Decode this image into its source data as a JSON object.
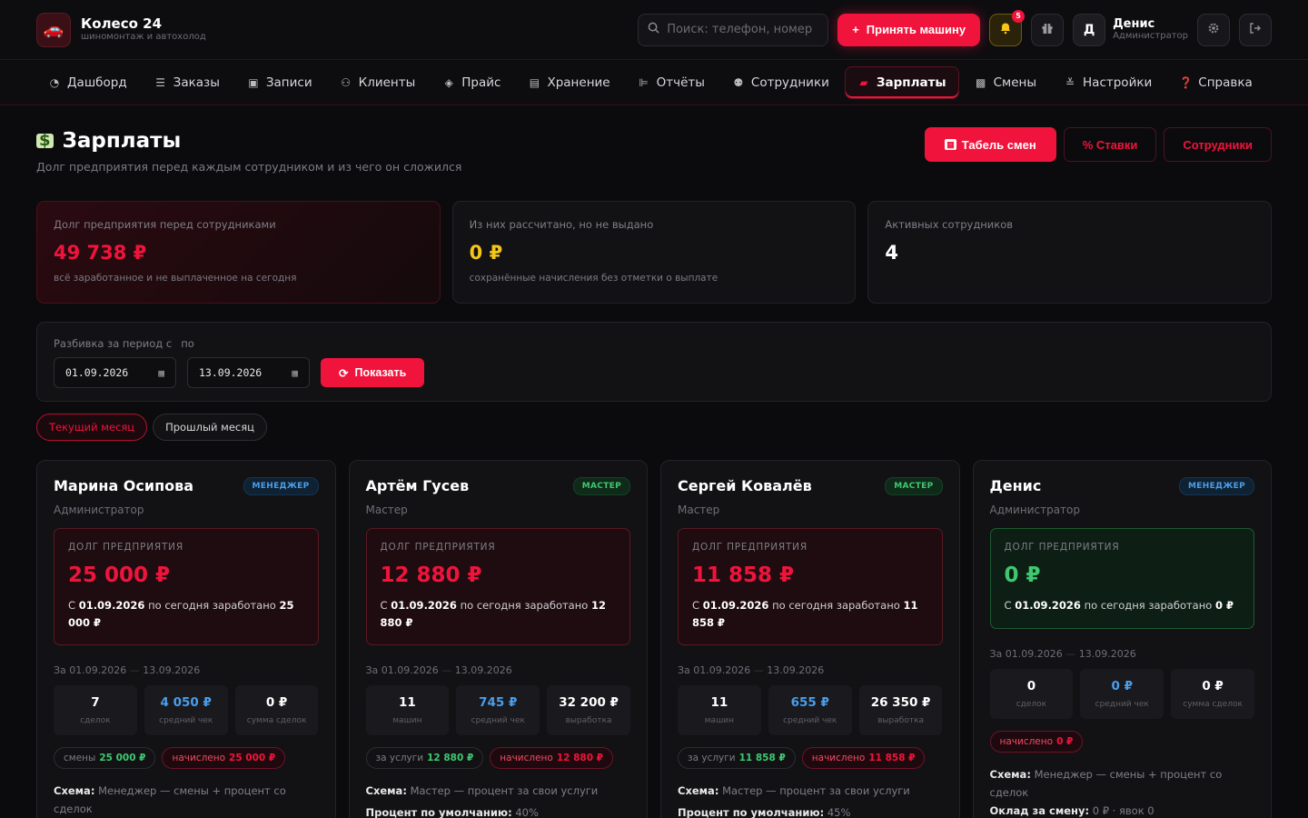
{
  "brand": {
    "title": "Колесо 24",
    "subtitle": "шиномонтаж и автохолод"
  },
  "header": {
    "search_placeholder": "Поиск: телефон, номер",
    "accept_label": "Принять машину",
    "notifications_count": "5",
    "user_initial": "Д",
    "user_name": "Денис",
    "user_role": "Администратор"
  },
  "nav": [
    {
      "label": "Дашборд",
      "icon": "chart-pie-icon"
    },
    {
      "label": "Заказы",
      "icon": "list-icon"
    },
    {
      "label": "Записи",
      "icon": "calendar-icon"
    },
    {
      "label": "Клиенты",
      "icon": "users-icon"
    },
    {
      "label": "Прайс",
      "icon": "tag-icon"
    },
    {
      "label": "Хранение",
      "icon": "warehouse-icon"
    },
    {
      "label": "Отчёты",
      "icon": "report-icon"
    },
    {
      "label": "Сотрудники",
      "icon": "staff-icon"
    },
    {
      "label": "Зарплаты",
      "icon": "money-icon",
      "active": true
    },
    {
      "label": "Смены",
      "icon": "shift-icon"
    },
    {
      "label": "Настройки",
      "icon": "sliders-icon"
    },
    {
      "label": "Справка",
      "icon": "help-icon"
    }
  ],
  "page": {
    "title": "Зарплаты",
    "subtitle": "Долг предприятия перед каждым сотрудником и из чего он сложился",
    "btn_timesheet": "Табель смен",
    "btn_rates": "% Ставки",
    "btn_staff": "Сотрудники"
  },
  "stats": [
    {
      "label": "Долг предприятия перед сотрудниками",
      "value": "49 738 ₽",
      "note": "всё заработанное и не выплаченное на сегодня",
      "color": "#f0143c"
    },
    {
      "label": "Из них рассчитано, но не выдано",
      "value": "0 ₽",
      "note": "сохранённые начисления без отметки о выплате",
      "color": "#f5c518"
    },
    {
      "label": "Активных сотрудников",
      "value": "4",
      "note": "",
      "color": "#ffffff"
    }
  ],
  "period": {
    "label_from": "Разбивка за период с",
    "label_to": "по",
    "date_from": "01.09.2026",
    "date_to": "13.09.2026",
    "show_label": "Показать",
    "chip_current": "Текущий месяц",
    "chip_previous": "Прошлый месяц"
  },
  "employees": [
    {
      "name": "Марина Осипова",
      "role": "Администратор",
      "badge": "МЕНЕДЖЕР",
      "debt_title": "ДОЛГ ПРЕДПРИЯТИЯ",
      "debt_value": "25 000 ₽",
      "debt_desc_pre": "С",
      "debt_from": "01.09.2026",
      "debt_desc_mid": "по сегодня заработано",
      "debt_earned": "25 000 ₽",
      "period_from": "За 01.09.2026",
      "period_to": "13.09.2026",
      "mini": [
        {
          "val": "7",
          "lbl": "сделок"
        },
        {
          "val": "4 050 ₽",
          "lbl": "средний чек"
        },
        {
          "val": "0 ₽",
          "lbl": "сумма сделок"
        }
      ],
      "pill1_pre": "смены",
      "pill1_val": "25 000 ₽",
      "pill2_pre": "начислено",
      "pill2_val": "25 000 ₽",
      "scheme_label": "Схема:",
      "scheme_text": "Менеджер — смены + процент со сделок",
      "line2_label": "",
      "line2_text": ""
    },
    {
      "name": "Артём Гусев",
      "role": "Мастер",
      "badge": "МАСТЕР",
      "debt_title": "ДОЛГ ПРЕДПРИЯТИЯ",
      "debt_value": "12 880 ₽",
      "debt_desc_pre": "С",
      "debt_from": "01.09.2026",
      "debt_desc_mid": "по сегодня заработано",
      "debt_earned": "12 880 ₽",
      "period_from": "За 01.09.2026",
      "period_to": "13.09.2026",
      "mini": [
        {
          "val": "11",
          "lbl": "машин"
        },
        {
          "val": "745 ₽",
          "lbl": "средний чек"
        },
        {
          "val": "32 200 ₽",
          "lbl": "выработка"
        }
      ],
      "pill1_pre": "за услуги",
      "pill1_val": "12 880 ₽",
      "pill2_pre": "начислено",
      "pill2_val": "12 880 ₽",
      "scheme_label": "Схема:",
      "scheme_text": "Мастер — процент за свои услуги",
      "line2_label": "Процент по умолчанию:",
      "line2_text": "40%"
    },
    {
      "name": "Сергей Ковалёв",
      "role": "Мастер",
      "badge": "МАСТЕР",
      "debt_title": "ДОЛГ ПРЕДПРИЯТИЯ",
      "debt_value": "11 858 ₽",
      "debt_desc_pre": "С",
      "debt_from": "01.09.2026",
      "debt_desc_mid": "по сегодня заработано",
      "debt_earned": "11 858 ₽",
      "period_from": "За 01.09.2026",
      "period_to": "13.09.2026",
      "mini": [
        {
          "val": "11",
          "lbl": "машин"
        },
        {
          "val": "655 ₽",
          "lbl": "средний чек"
        },
        {
          "val": "26 350 ₽",
          "lbl": "выработка"
        }
      ],
      "pill1_pre": "за услуги",
      "pill1_val": "11 858 ₽",
      "pill2_pre": "начислено",
      "pill2_val": "11 858 ₽",
      "scheme_label": "Схема:",
      "scheme_text": "Мастер — процент за свои услуги",
      "line2_label": "Процент по умолчанию:",
      "line2_text": "45%"
    },
    {
      "name": "Денис",
      "role": "Администратор",
      "badge": "МЕНЕДЖЕР",
      "debt_title": "ДОЛГ ПРЕДПРИЯТИЯ",
      "debt_value": "0 ₽",
      "debt_desc_pre": "С",
      "debt_from": "01.09.2026",
      "debt_desc_mid": "по сегодня заработано",
      "debt_earned": "0 ₽",
      "period_from": "За 01.09.2026",
      "period_to": "13.09.2026",
      "mini": [
        {
          "val": "0",
          "lbl": "сделок"
        },
        {
          "val": "0 ₽",
          "lbl": "средний чек"
        },
        {
          "val": "0 ₽",
          "lbl": "сумма сделок"
        }
      ],
      "pill1_pre": "",
      "pill1_val": "",
      "pill2_pre": "начислено",
      "pill2_val": "0 ₽",
      "scheme_label": "Схема:",
      "scheme_text": "Менеджер — смены + процент со сделок",
      "line2_label": "Оклад за смену:",
      "line2_text": "0 ₽ · явок 0"
    }
  ]
}
